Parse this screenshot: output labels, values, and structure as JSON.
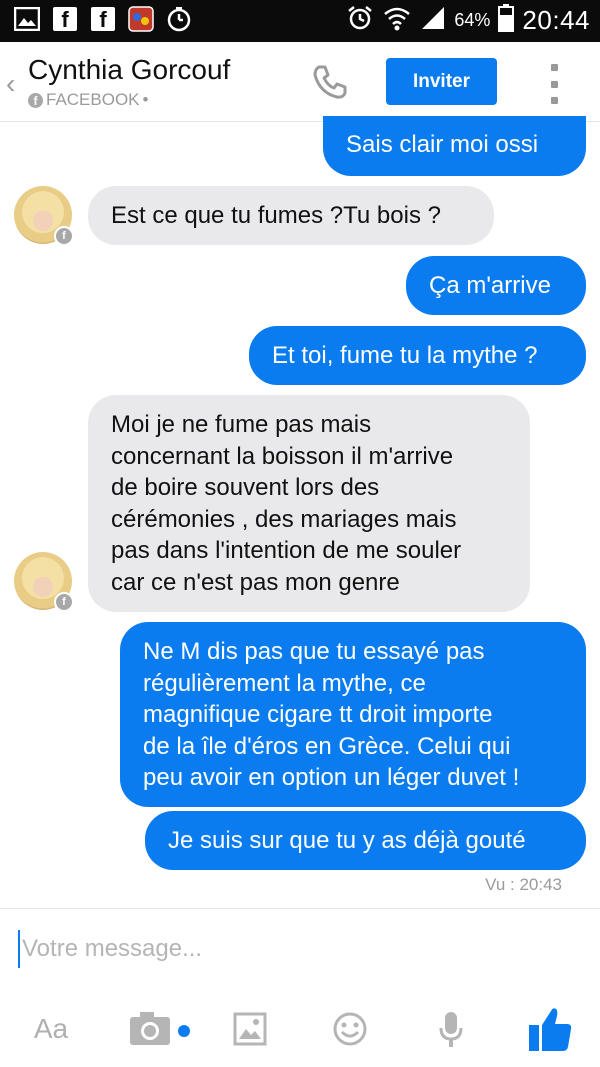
{
  "status_bar": {
    "battery": "64%",
    "time": "20:44",
    "icons": [
      "image-icon",
      "facebook-icon",
      "facebook-icon",
      "app-icon",
      "timer-icon",
      "alarm-icon",
      "wifi-icon",
      "signal-icon",
      "battery-icon"
    ]
  },
  "header": {
    "back_icon": "‹",
    "name": "Cynthia Gorcouf",
    "source": "FACEBOOK",
    "source_suffix": "•",
    "invite_label": "Inviter"
  },
  "messages": [
    {
      "dir": "out",
      "text": "Sais clair moi ossi"
    },
    {
      "dir": "in",
      "text": "Est ce que tu fumes ?Tu bois ?"
    },
    {
      "dir": "out",
      "text": "Ça m'arrive"
    },
    {
      "dir": "out",
      "text": "Et toi, fume tu la mythe ?"
    },
    {
      "dir": "in",
      "lines": [
        "Moi je ne fume pas mais",
        "concernant la boisson il m'arrive",
        "de boire souvent lors des",
        "cérémonies , des mariages mais",
        "pas dans l'intention de me souler",
        "car ce n'est pas mon genre"
      ]
    },
    {
      "dir": "out",
      "lines": [
        "Ne M dis pas que tu essayé pas",
        "régulièrement la mythe, ce",
        "magnifique cigare tt droit importe",
        "de la île d'éros en Grèce.  Celui qui",
        "peu avoir en option un léger duvet !"
      ]
    },
    {
      "dir": "out",
      "text": "Je suis sur que tu y as déjà gouté"
    }
  ],
  "seen": "Vu : 20:43",
  "composer": {
    "placeholder": "Votre message..."
  },
  "toolbar": {
    "text_label": "Aa"
  },
  "colors": {
    "accent": "#0a7cf0",
    "incoming": "#e9e9eb"
  }
}
